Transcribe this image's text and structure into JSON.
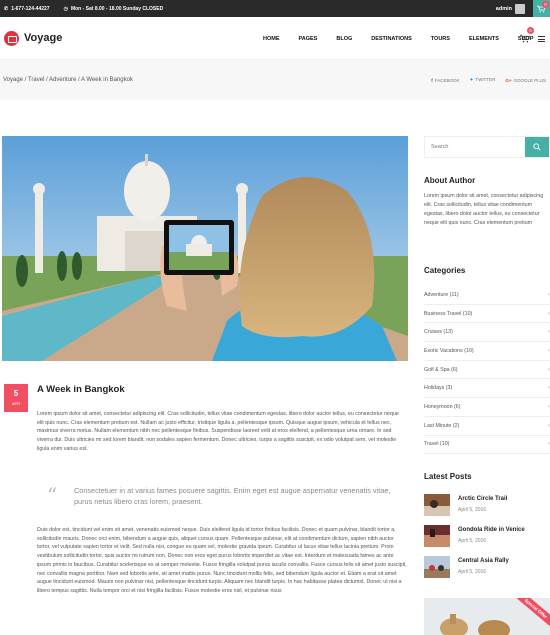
{
  "topbar": {
    "phone": "1-677-124-44227",
    "hours": "Mon - Sat 8.00 - 18.00 Sunday CLOSED",
    "user": "admin",
    "cart_count": "0"
  },
  "header": {
    "logo": "Voyage",
    "nav": [
      "HOME",
      "PAGES",
      "BLOG",
      "DESTINATIONS",
      "TOURS",
      "ELEMENTS",
      "SHOP"
    ],
    "cart_count": "0"
  },
  "breadcrumb": {
    "text": "Voyage / Travel / Adventure / A Week in Bangkok",
    "share": [
      "FACEBOOK",
      "TWITTER",
      "GOOGLE PLUS"
    ]
  },
  "post": {
    "day": "5",
    "month": "APR",
    "title": "A Week in Bangkok",
    "intro": "Lorem ipsum dolor sit amet, consectetur adipiscing elit. Cras sollicitudin, tellus vitae condimentum egestas, libero dolor auctor tellus, eu consectetur neque elit quis nunc. Cras elementum pretium est. Nullam ac justo efficitur, tristique ligula a, pellentesque ipsum. Quisque augue ipsum, vehicula et tellus nec, maximus viverra metus. Nullam elementum nibh nec pellentesque finibus. Suspendisse laoreet velit at eros eleifend, a pellentesque urna ornare. In sed viverra dui. Duis ultricies mi sed lorem blandit, non sodales sapien fermentum. Donec ultricies, turpis a sagittis suscipit, ex odio volutpat sem, vel molestie ligula enim varius est.",
    "quote": "Consectetuer in at varius fames posuere sagittis. Enim eget est augue aspernatur venenatis vitae, purus netus libero cras lorem, praesent.",
    "body": "Duis dolor est, tincidunt vel enim sit amet, venenatis euismod neque. Duis eleifend ligula id tortor finibus facilisis. Donec et quam pulvinar, blandit tortor a, sollicitudin mauris. Donec orci enim, bibendum a augue quis, aliquet cursus quam. Pellentesque pulvinar, elit at condimentum dictum, sapien nibh auctor tortor, vel vulputate sapien tortor et velit. Sed nulla nisi, congue eu quam vel, molestie gravida ipsum. Curabitur ut lacus vitae tellus lacinia pretium. Proin vestibulum sollicitudin tortor, quis auctor mi rutrum non. Donec non eros eget purus lobortis imperdiet ac vitae est. Interdum et malesuada fames ac ante ipsum primis in faucibus. Curabitur scelerisque ex at semper molestie. Fusce fringilla volutpat purus iaculis convallis. Fusce cursus felis sit amet justo suscipit, nec convallis magna porttitor. Nam sed lobortis ante, sit amet mattis purus. Nunc tincidunt mollis felis, sed bibendum ligula auctor et. Etiam a erat sit amet augue tincidunt euismod. Mauris non pulvinar nisi, pellentesque tincidunt turpis. Aliquam nec blandit turpis. In hac habitasse platea dictumst. Donec ut nisi a libero tempus sagittis. Nulla tempor orci et nisi fringilla facilisis. Fusce molestie eros nisl, et pulvinar risus"
  },
  "sidebar": {
    "search_placeholder": "Search",
    "about_title": "About Author",
    "about_text": "Lorem ipsum dolor sit amet, consectetur adipiscing elit. Cras sollicitudin, tellus vitae condimentum egestas, libero dolor auctor tellus, eu consectetur neque elit quis nunc. Cras elementum pretium",
    "categories_title": "Categories",
    "categories": [
      "Adventure (11)",
      "Business Travel (10)",
      "Cruises (13)",
      "Exotic Vacations (10)",
      "Golf & Spa (6)",
      "Holidays (3)",
      "Honeymoon (6)",
      "Last Minute (2)",
      "Travel (10)"
    ],
    "latest_title": "Latest Posts",
    "latest": [
      {
        "title": "Arctic Circle Trail",
        "date": "April 5, 2016"
      },
      {
        "title": "Gondola Ride in Venice",
        "date": "April 5, 2016"
      },
      {
        "title": "Central Asia Rally",
        "date": "April 5, 2016"
      }
    ],
    "offer_ribbon": "Special Offer"
  },
  "colors": {
    "accent": "#47b0a6",
    "brand": "#ef4f61",
    "dark": "#2a2a2a"
  }
}
